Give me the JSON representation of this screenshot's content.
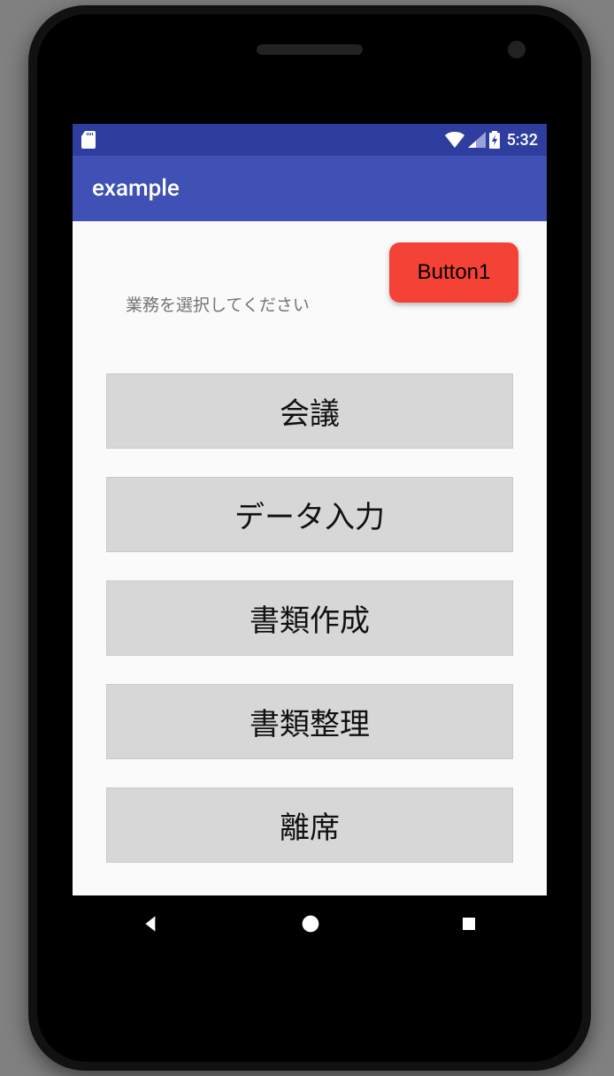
{
  "status": {
    "time": "5:32"
  },
  "appbar": {
    "title": "example"
  },
  "content": {
    "prompt": "業務を選択してください",
    "button1": "Button1",
    "tasks": [
      {
        "label": "会議"
      },
      {
        "label": "データ入力"
      },
      {
        "label": "書類作成"
      },
      {
        "label": "書類整理"
      },
      {
        "label": "離席"
      }
    ]
  }
}
